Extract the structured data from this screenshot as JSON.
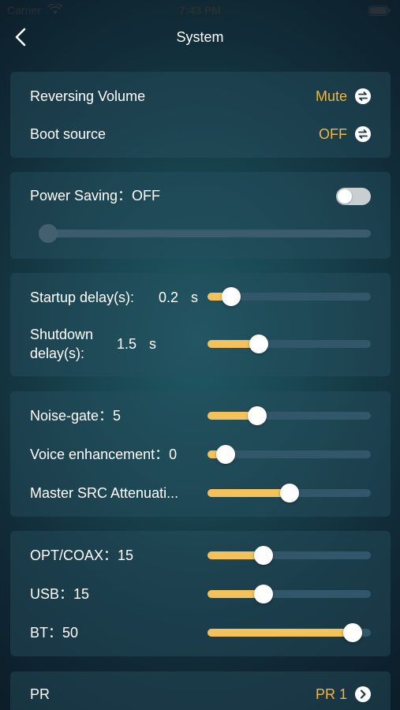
{
  "status_bar": {
    "carrier": "Carrier",
    "time": "7:43 PM"
  },
  "nav": {
    "title": "System"
  },
  "audio_card": {
    "reversing_volume": {
      "label": "Reversing Volume",
      "value": "Mute"
    },
    "boot_source": {
      "label": "Boot source",
      "value": "OFF"
    }
  },
  "power_card": {
    "label": "Power Saving：OFF",
    "toggle_on": false,
    "slider_fraction": 0.0
  },
  "delay_card": {
    "startup": {
      "label": "Startup delay(s):",
      "value": "0.2",
      "unit": "s",
      "fraction": 0.1
    },
    "shutdown": {
      "label": "Shutdown delay(s):",
      "value": "1.5",
      "unit": "s",
      "fraction": 0.29
    }
  },
  "sound_card": {
    "noise_gate": {
      "label": "Noise-gate：5",
      "fraction": 0.28
    },
    "voice_enhancement": {
      "label": "Voice enhancement：0",
      "fraction": 0.06
    },
    "master_src": {
      "label": "Master SRC Attenuati...",
      "fraction": 0.5
    }
  },
  "input_card": {
    "opt_coax": {
      "label": "OPT/COAX：15",
      "fraction": 0.32
    },
    "usb": {
      "label": "USB：15",
      "fraction": 0.32
    },
    "bt": {
      "label": "BT：50",
      "fraction": 0.94
    }
  },
  "pr_card": {
    "label": "PR",
    "value": "PR 1"
  },
  "colors": {
    "accent": "#f2b641",
    "fill": "#f5c15a",
    "track": "#33576a"
  },
  "icons": {
    "back": "chevron-left-icon",
    "swap": "swap-arrows-icon",
    "chevron": "chevron-right-circle-icon"
  }
}
